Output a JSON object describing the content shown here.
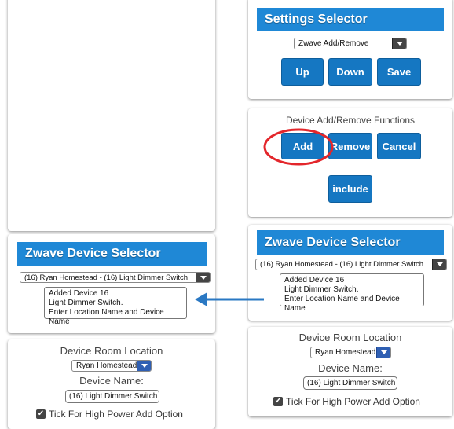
{
  "settings_selector": {
    "title": "Settings Selector",
    "dropdown_value": "Zwave Add/Remove",
    "up_label": "Up",
    "down_label": "Down",
    "save_label": "Save"
  },
  "functions_panel": {
    "heading": "Device Add/Remove Functions",
    "add_label": "Add",
    "remove_label": "Remove",
    "cancel_label": "Cancel",
    "include_label": "include",
    "highlight_color": "#e3262b"
  },
  "right_selector": {
    "title": "Zwave Device Selector",
    "device_dropdown_value": "(16) Ryan Homestead - (16) Light Dimmer Switch",
    "status_lines": [
      "Added Device 16",
      "Light Dimmer Switch.",
      "Enter Location Name and Device Name"
    ]
  },
  "right_details": {
    "room_label": "Device Room Location",
    "room_value": "Ryan Homestead",
    "name_label": "Device Name:",
    "name_value": "(16) Light Dimmer Switch",
    "checkbox_label": "Tick For High Power Add Option"
  },
  "left_selector": {
    "title": "Zwave Device Selector",
    "device_dropdown_value": "(16) Ryan Homestead - (16) Light Dimmer Switch",
    "status_lines": [
      "Added Device 16",
      "Light Dimmer Switch.",
      "Enter Location Name and Device Name"
    ]
  },
  "left_details": {
    "room_label": "Device Room Location",
    "room_value": "Ryan Homestead",
    "name_label": "Device Name:",
    "name_value": "(16) Light Dimmer Switch",
    "checkbox_label": "Tick For High Power Add Option"
  },
  "arrow_color": "#2a78c3"
}
